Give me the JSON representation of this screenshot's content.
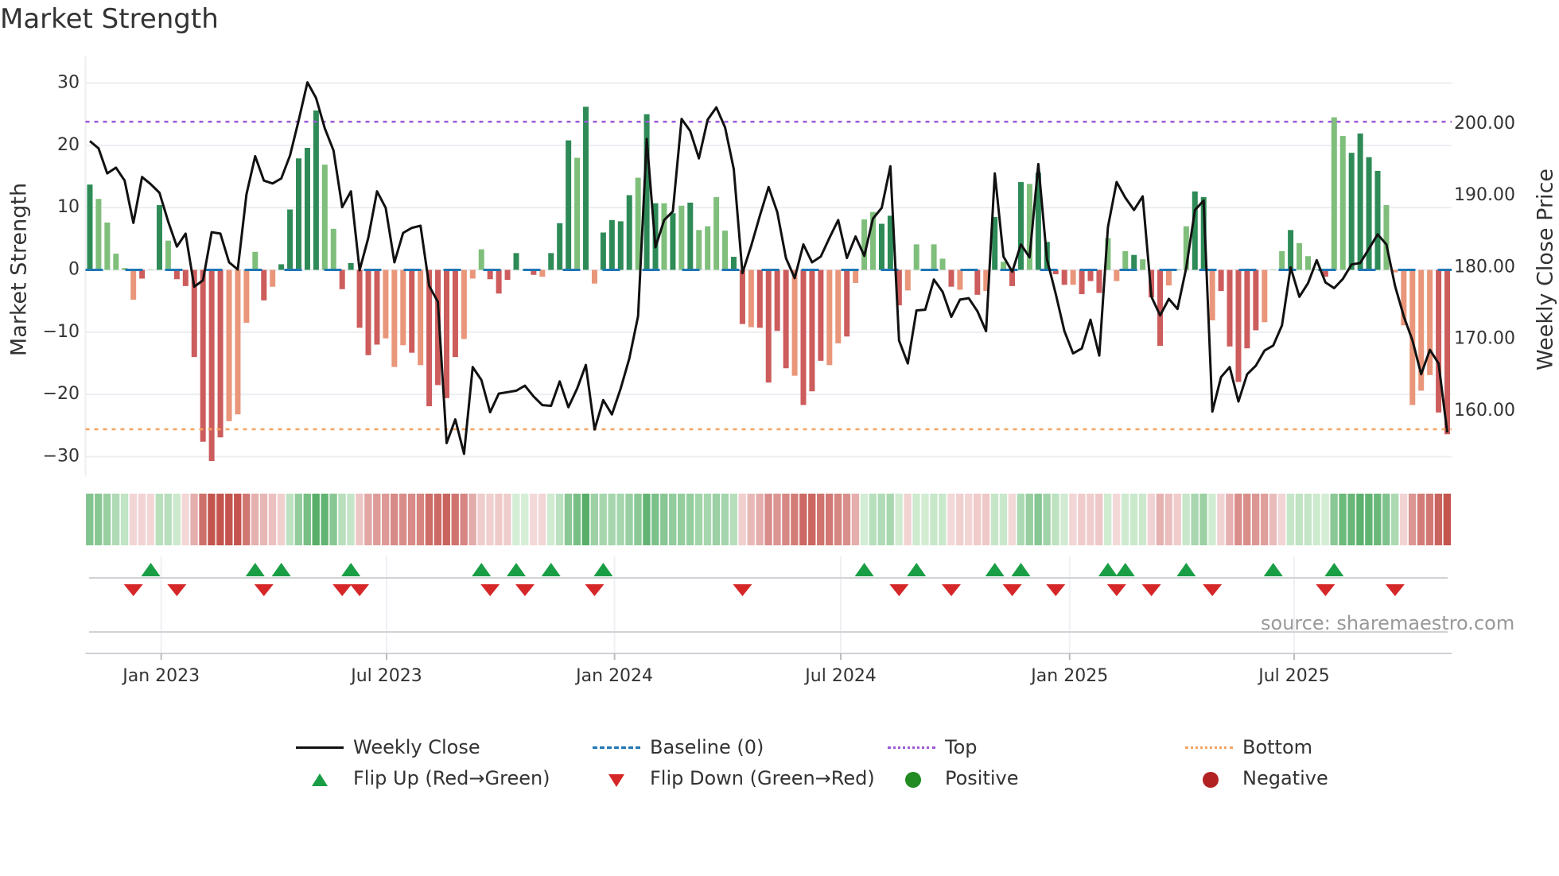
{
  "title": "Market Strength",
  "source": "source: sharemaestro.com",
  "legend": {
    "weekly_close": "Weekly Close",
    "baseline": "Baseline (0)",
    "top": "Top",
    "bottom": "Bottom",
    "flip_up": "Flip Up (Red→Green)",
    "flip_down": "Flip Down (Green→Red)",
    "positive": "Positive",
    "negative": "Negative"
  },
  "colors": {
    "bar_pos_dark": "#2e8b57",
    "bar_pos_light": "#7fbf7b",
    "bar_neg_dark": "#cd5c5c",
    "bar_neg_light": "#e9967a",
    "close": "#111111",
    "baseline": "#1f77b4",
    "top": "#9b59d6",
    "bottom": "#f4a460",
    "flip_up": "#1a9e45",
    "flip_down": "#d62728",
    "positive": "#228b22",
    "negative": "#b22222"
  },
  "chart_data": {
    "type": "bar",
    "title": "Market Strength",
    "ylabel": "Market Strength",
    "y2label": "Weekly Close Price",
    "ylim": [
      -33,
      33
    ],
    "y2lim": [
      151,
      208.3
    ],
    "yticks": [
      -30,
      -20,
      -10,
      0,
      10,
      20,
      30
    ],
    "ytick_labels": [
      "−30",
      "−20",
      "−10",
      "0",
      "10",
      "20",
      "30"
    ],
    "y2ticks": [
      160,
      170,
      180,
      190,
      200
    ],
    "y2tick_labels": [
      "160.00",
      "170.00",
      "180.00",
      "190.00",
      "200.00"
    ],
    "x_unit": "week index",
    "xticks": [
      8.2,
      34.1,
      60.3,
      86.3,
      112.6,
      138.4
    ],
    "xtick_labels": [
      "Jan 2023",
      "Jul 2023",
      "Jan 2024",
      "Jul 2024",
      "Jan 2025",
      "Jul 2025"
    ],
    "top_level": 23.8,
    "bottom_level": -25.6,
    "baseline": 0,
    "strength": [
      13.7,
      11.4,
      7.6,
      2.6,
      0.3,
      -4.8,
      -1.4,
      0,
      10.4,
      4.7,
      -1.5,
      -2.6,
      -14,
      -27.6,
      -30.7,
      -26.9,
      -24.3,
      -23.2,
      -8.5,
      2.9,
      -4.9,
      -2.7,
      0.9,
      9.7,
      17.9,
      19.6,
      25.6,
      16.9,
      6.6,
      -3.1,
      1.1,
      -9.3,
      -13.7,
      -12,
      -11,
      -15.6,
      -12.1,
      -13.3,
      -15.3,
      -21.9,
      -18.5,
      -20.6,
      -14,
      -11.1,
      -1.4,
      3.3,
      -1.5,
      -3.8,
      -1.6,
      2.7,
      0,
      -0.8,
      -1.1,
      2.7,
      7.5,
      20.8,
      18,
      26.2,
      -2.2,
      6,
      8,
      7.8,
      12,
      14.8,
      25,
      10.7,
      10.7,
      9.1,
      10.3,
      10.8,
      6.4,
      7,
      11.7,
      6.3,
      2.1,
      -8.7,
      -9.2,
      -9.3,
      -18.1,
      -9.8,
      -15.8,
      -17,
      -21.7,
      -19.5,
      -14.6,
      -15.3,
      -11.8,
      -10.7,
      -2.1,
      8.1,
      9.3,
      7.4,
      8.7,
      -5.7,
      -3.3,
      4.1,
      0,
      4.1,
      1.8,
      -2.7,
      -3.2,
      -0.2,
      -4,
      -3.4,
      8.5,
      1.3,
      -2.6,
      14.1,
      13.8,
      15.6,
      4.5,
      -0.7,
      -2.4,
      -2.4,
      -3.9,
      -1.8,
      -3.7,
      5.1,
      -1.8,
      3,
      2.4,
      1.7,
      -4.4,
      -12.2,
      -2.5,
      0,
      7,
      12.6,
      11.7,
      -8.1,
      -3.4,
      -12.3,
      -18,
      -12.6,
      -9.7,
      -8.4,
      0,
      3,
      6.4,
      4.3,
      2.2,
      0,
      -1.1,
      24.5,
      21.5,
      18.8,
      21.9,
      18.1,
      15.9,
      10.4,
      -0.4,
      -8.9,
      -21.7,
      -19.4,
      -16.9,
      -22.9,
      -26.4
    ],
    "shade": "dllllldldlddddddlllldldddddlldddddllldlddddlllddddldldddldlddddlddldldllllddlddddldddlldllldddlldlldlddldlddlddddldddllldlddldlddldddddllldllddllddddlllllldddllldd",
    "weekly_close": [
      197.6,
      196.6,
      193.1,
      193.9,
      192.1,
      186.2,
      192.6,
      191.6,
      190.4,
      186.4,
      182.9,
      184.7,
      177.3,
      178.2,
      184.9,
      184.7,
      180.7,
      179.7,
      190.2,
      195.5,
      192.1,
      191.7,
      192.4,
      195.6,
      200.5,
      205.8,
      203.6,
      199.4,
      196.3,
      188.4,
      190.6,
      179.6,
      184.1,
      190.6,
      188.3,
      180.7,
      184.8,
      185.5,
      185.8,
      177.4,
      175.2,
      155.5,
      158.8,
      154,
      166.1,
      164.3,
      159.8,
      162.4,
      162.6,
      162.8,
      163.5,
      162,
      160.8,
      160.7,
      164.1,
      160.5,
      163.1,
      166.4,
      157.4,
      161.5,
      159.5,
      163.1,
      167.3,
      173.2,
      197.9,
      182.8,
      186.6,
      187.8,
      200.7,
      199,
      195.2,
      200.6,
      202.3,
      199.5,
      193.7,
      179.2,
      183,
      187.2,
      191.2,
      187.7,
      181.3,
      178.5,
      183.2,
      180.7,
      181.5,
      184.1,
      186.6,
      181.3,
      184.3,
      181.6,
      186.8,
      188.3,
      194.1,
      169.8,
      166.6,
      174,
      174.1,
      178.3,
      176.6,
      173.1,
      175.5,
      175.7,
      173.9,
      171.1,
      193.1,
      181.5,
      179.4,
      183.2,
      181.4,
      194.4,
      181.1,
      176.3,
      171.1,
      168,
      168.7,
      172.7,
      167.7,
      185.6,
      191.9,
      189.7,
      188,
      189.9,
      175.9,
      173.3,
      175.6,
      174.2,
      179.9,
      188,
      189.3,
      159.9,
      164.7,
      166.1,
      161.3,
      165.1,
      166.3,
      168.4,
      169.1,
      171.9,
      180,
      175.9,
      177.8,
      181,
      177.9,
      177.1,
      178.4,
      180.4,
      180.6,
      182.6,
      184.6,
      183.2,
      177.4,
      173.2,
      169.8,
      165.1,
      168.5,
      166.6,
      157
    ],
    "flip_up": [
      7,
      19,
      22,
      30,
      45,
      49,
      53,
      59,
      89,
      95,
      104,
      107,
      117,
      119,
      126,
      136,
      143
    ],
    "flip_down": [
      5,
      10,
      20,
      29,
      31,
      46,
      50,
      58,
      75,
      93,
      99,
      106,
      111,
      118,
      122,
      129,
      142,
      150
    ],
    "legend_position": "bottom"
  }
}
